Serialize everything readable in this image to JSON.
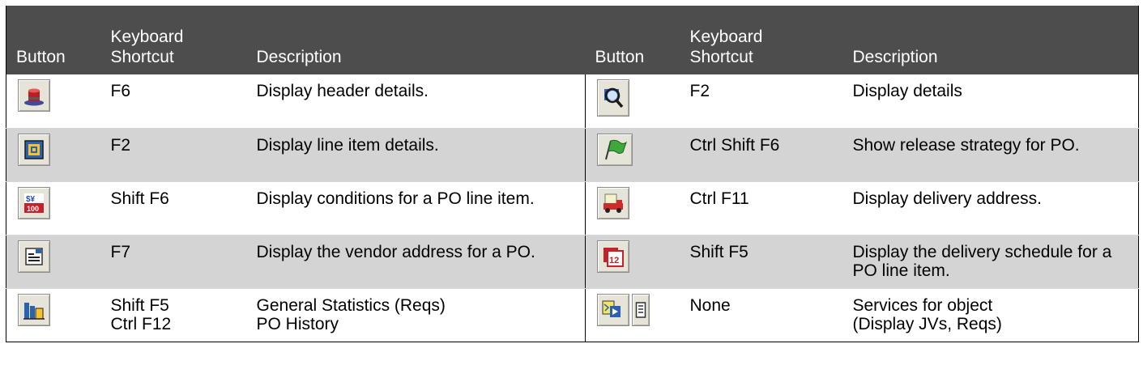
{
  "columns": {
    "button": "Button",
    "shortcut_line1": "Keyboard",
    "shortcut_line2": "Shortcut",
    "description": "Description"
  },
  "rows": [
    {
      "left": {
        "icon": "hat-icon",
        "shortcut": "F6",
        "description": "Display header details."
      },
      "right": {
        "icon": "magnifier-icon",
        "shortcut": "F2",
        "description": "Display details"
      }
    },
    {
      "left": {
        "icon": "line-item-icon",
        "shortcut": "F2",
        "description": "Display line item details."
      },
      "right": {
        "icon": "green-flag-icon",
        "shortcut": "Ctrl Shift F6",
        "description": "Show release strategy for PO."
      }
    },
    {
      "left": {
        "icon": "currency-conditions-icon",
        "shortcut": "Shift F6",
        "description": "Display conditions for a PO line item."
      },
      "right": {
        "icon": "delivery-truck-icon",
        "shortcut": "Ctrl F11",
        "description": "Display delivery address."
      }
    },
    {
      "left": {
        "icon": "address-card-icon",
        "shortcut": "F7",
        "description": "Display the vendor address for a PO."
      },
      "right": {
        "icon": "calendar-12-icon",
        "shortcut": "Shift F5",
        "description": "Display the delivery schedule for a PO line item."
      }
    },
    {
      "left": {
        "icon": "bar-chart-icon",
        "shortcut_lines": [
          "Shift F5",
          "Ctrl F12"
        ],
        "description_lines": [
          "General Statistics (Reqs)",
          "PO History"
        ]
      },
      "right": {
        "icons": [
          "services-for-object-icon",
          "document-menu-icon"
        ],
        "shortcut": "None",
        "description_lines": [
          "Services for object",
          "(Display JVs, Reqs)"
        ]
      }
    }
  ]
}
